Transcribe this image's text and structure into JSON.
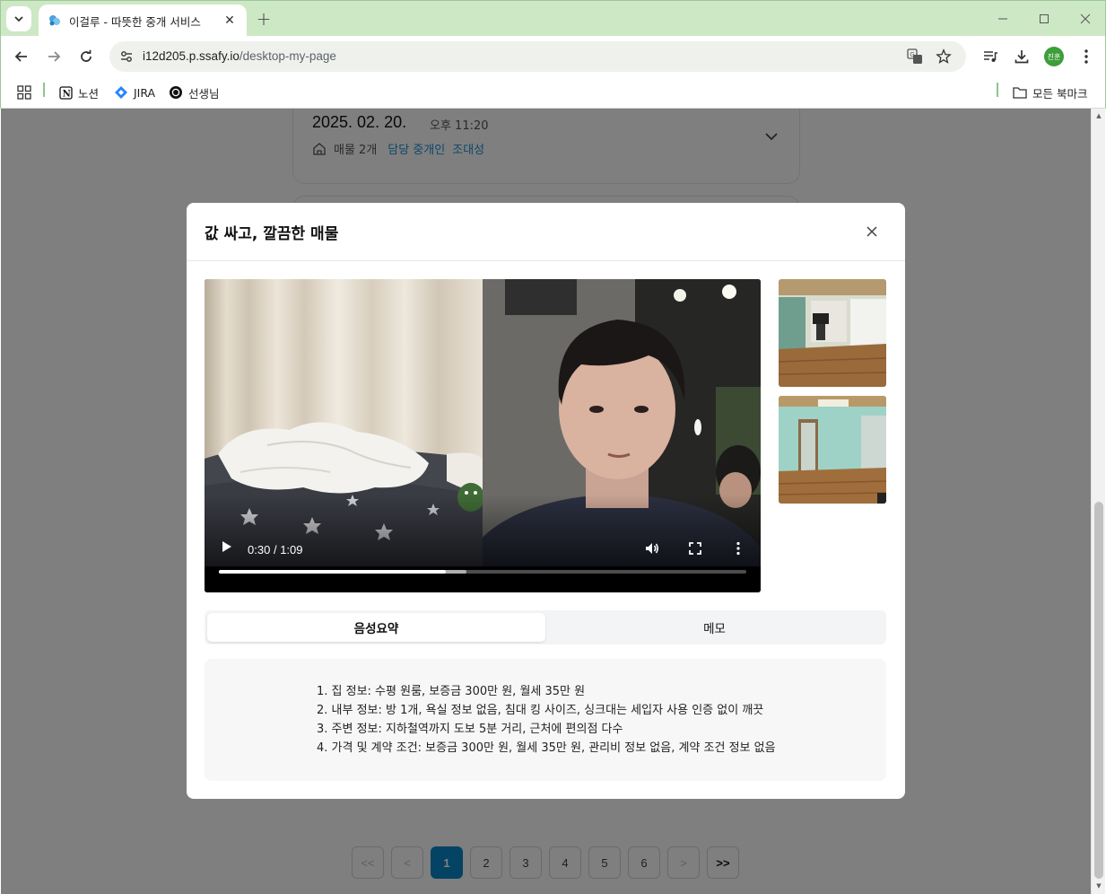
{
  "browser": {
    "tab_title": "이걸루 - 따뜻한 중개 서비스",
    "url_host": "i12d205.p.ssafy.io",
    "url_path": "/desktop-my-page",
    "profile_initials": "진훈",
    "accent_color": "#cde8c5",
    "bookmarks": [
      {
        "label": "노션",
        "icon": "notion-icon"
      },
      {
        "label": "JIRA",
        "icon": "jira-icon"
      },
      {
        "label": "선생님",
        "icon": "openai-icon"
      }
    ],
    "all_bookmarks_label": "모든 북마크"
  },
  "history": {
    "date": "2025. 02. 20.",
    "time": "오후 11:20",
    "listing_count": "매물 2개",
    "agent_label": "담당 중개인",
    "agent_name": "조대성"
  },
  "modal": {
    "title": "값 싸고, 깔끔한 매물",
    "video": {
      "current_time": "0:30",
      "separator": "/",
      "duration": "1:09",
      "played_fraction": 0.43,
      "buffered_fraction": 0.47
    },
    "tabs": [
      {
        "label": "음성요약",
        "active": true
      },
      {
        "label": "메모",
        "active": false
      }
    ],
    "summary": [
      "1. 집 정보: 수평 원룸, 보증금 300만 원, 월세 35만 원",
      "2. 내부 정보: 방 1개, 욕실 정보 없음, 침대 킹 사이즈, 싱크대는 세입자 사용 인증 없이 깨끗",
      "3. 주변 정보: 지하철역까지 도보 5분 거리, 근처에 편의점 다수",
      "4. 가격 및 계약 조건: 보증금 300만 원, 월세 35만 원, 관리비 정보 없음, 계약 조건 정보 없음"
    ]
  },
  "pagination": {
    "first": "<<",
    "prev": "<",
    "pages": [
      "1",
      "2",
      "3",
      "4",
      "5",
      "6"
    ],
    "current": "1",
    "next": ">",
    "last": ">>",
    "active_color": "#0b86c9"
  }
}
